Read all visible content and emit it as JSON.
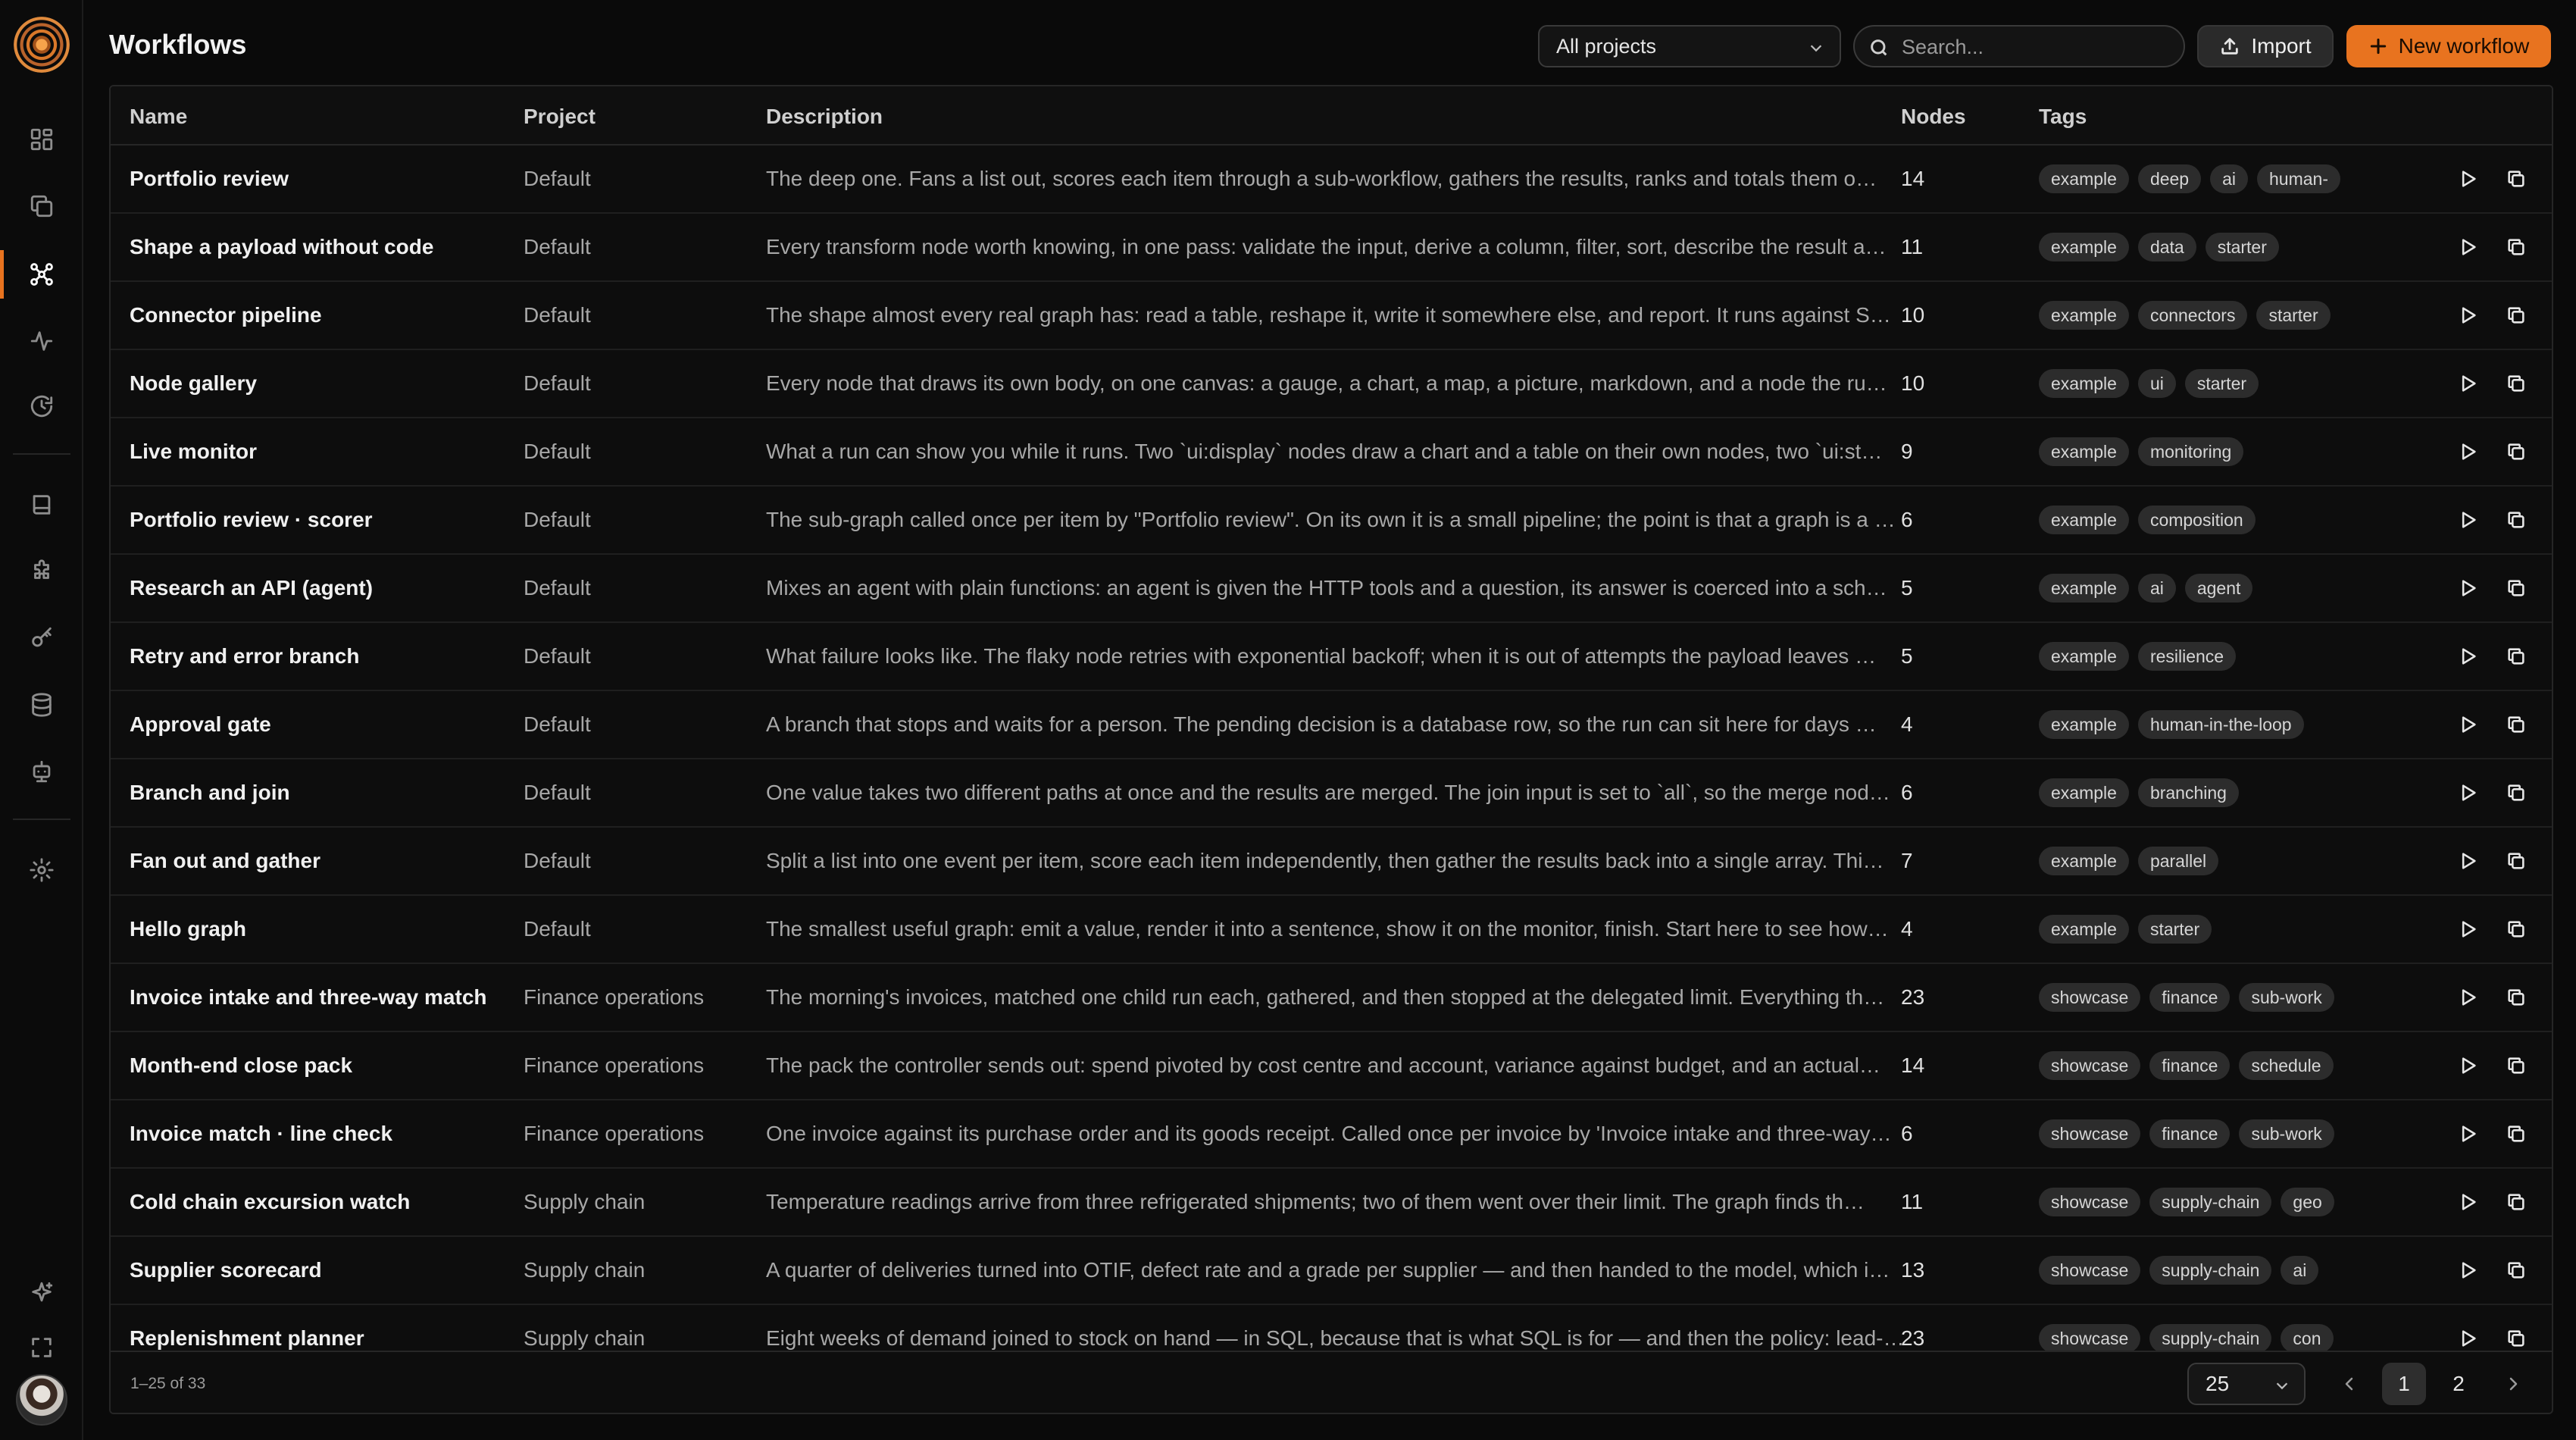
{
  "page": {
    "title": "Workflows"
  },
  "toolbar": {
    "project_filter": "All projects",
    "search_placeholder": "Search...",
    "import_label": "Import",
    "new_label": "New workflow",
    "accent": "#e8731f"
  },
  "sidebar": {
    "items": [
      {
        "name": "dashboard-icon"
      },
      {
        "name": "copy-stack-icon"
      },
      {
        "name": "workflows-icon",
        "active": true
      },
      {
        "name": "activity-icon"
      },
      {
        "name": "history-icon"
      },
      {
        "name": "book-icon"
      },
      {
        "name": "puzzle-icon"
      },
      {
        "name": "key-icon"
      },
      {
        "name": "database-icon"
      },
      {
        "name": "robot-icon"
      },
      {
        "name": "settings-icon"
      },
      {
        "name": "sparkle-icon"
      },
      {
        "name": "fullscreen-icon"
      }
    ]
  },
  "table": {
    "columns": {
      "name": "Name",
      "project": "Project",
      "description": "Description",
      "nodes": "Nodes",
      "tags": "Tags"
    },
    "rows": [
      {
        "name": "Portfolio review",
        "project": "Default",
        "description": "The deep one. Fans a list out, scores each item through a sub-workflow, gathers the results, ranks and totals them o…",
        "nodes": "14",
        "tags": [
          "example",
          "deep",
          "ai",
          "human-"
        ]
      },
      {
        "name": "Shape a payload without code",
        "project": "Default",
        "description": "Every transform node worth knowing, in one pass: validate the input, derive a column, filter, sort, describe the result a…",
        "nodes": "11",
        "tags": [
          "example",
          "data",
          "starter"
        ]
      },
      {
        "name": "Connector pipeline",
        "project": "Default",
        "description": "The shape almost every real graph has: read a table, reshape it, write it somewhere else, and report. It runs against S…",
        "nodes": "10",
        "tags": [
          "example",
          "connectors",
          "starter"
        ]
      },
      {
        "name": "Node gallery",
        "project": "Default",
        "description": "Every node that draws its own body, on one canvas: a gauge, a chart, a map, a picture, markdown, and a node the ru…",
        "nodes": "10",
        "tags": [
          "example",
          "ui",
          "starter"
        ]
      },
      {
        "name": "Live monitor",
        "project": "Default",
        "description": "What a run can show you while it runs. Two `ui:display` nodes draw a chart and a table on their own nodes, two `ui:st…",
        "nodes": "9",
        "tags": [
          "example",
          "monitoring"
        ]
      },
      {
        "name": "Portfolio review · scorer",
        "project": "Default",
        "description": "The sub-graph called once per item by \"Portfolio review\". On its own it is a small pipeline; the point is that a graph is a …",
        "nodes": "6",
        "tags": [
          "example",
          "composition"
        ]
      },
      {
        "name": "Research an API (agent)",
        "project": "Default",
        "description": "Mixes an agent with plain functions: an agent is given the HTTP tools and a question, its answer is coerced into a sch…",
        "nodes": "5",
        "tags": [
          "example",
          "ai",
          "agent"
        ]
      },
      {
        "name": "Retry and error branch",
        "project": "Default",
        "description": "What failure looks like. The flaky node retries with exponential backoff; when it is out of attempts the payload leaves …",
        "nodes": "5",
        "tags": [
          "example",
          "resilience"
        ]
      },
      {
        "name": "Approval gate",
        "project": "Default",
        "description": "A branch that stops and waits for a person. The pending decision is a database row, so the run can sit here for days …",
        "nodes": "4",
        "tags": [
          "example",
          "human-in-the-loop"
        ]
      },
      {
        "name": "Branch and join",
        "project": "Default",
        "description": "One value takes two different paths at once and the results are merged. The join input is set to `all`, so the merge nod…",
        "nodes": "6",
        "tags": [
          "example",
          "branching"
        ]
      },
      {
        "name": "Fan out and gather",
        "project": "Default",
        "description": "Split a list into one event per item, score each item independently, then gather the results back into a single array. Thi…",
        "nodes": "7",
        "tags": [
          "example",
          "parallel"
        ]
      },
      {
        "name": "Hello graph",
        "project": "Default",
        "description": "The smallest useful graph: emit a value, render it into a sentence, show it on the monitor, finish. Start here to see how…",
        "nodes": "4",
        "tags": [
          "example",
          "starter"
        ]
      },
      {
        "name": "Invoice intake and three-way match",
        "project": "Finance operations",
        "description": "The morning's invoices, matched one child run each, gathered, and then stopped at the delegated limit. Everything th…",
        "nodes": "23",
        "tags": [
          "showcase",
          "finance",
          "sub-work"
        ]
      },
      {
        "name": "Month-end close pack",
        "project": "Finance operations",
        "description": "The pack the controller sends out: spend pivoted by cost centre and account, variance against budget, and an actual…",
        "nodes": "14",
        "tags": [
          "showcase",
          "finance",
          "schedule"
        ]
      },
      {
        "name": "Invoice match · line check",
        "project": "Finance operations",
        "description": "One invoice against its purchase order and its goods receipt. Called once per invoice by 'Invoice intake and three-way…",
        "nodes": "6",
        "tags": [
          "showcase",
          "finance",
          "sub-work"
        ]
      },
      {
        "name": "Cold chain excursion watch",
        "project": "Supply chain",
        "description": "Temperature readings arrive from three refrigerated shipments; two of them went over their limit. The graph finds th…",
        "nodes": "11",
        "tags": [
          "showcase",
          "supply-chain",
          "geo"
        ]
      },
      {
        "name": "Supplier scorecard",
        "project": "Supply chain",
        "description": "A quarter of deliveries turned into OTIF, defect rate and a grade per supplier — and then handed to the model, which i…",
        "nodes": "13",
        "tags": [
          "showcase",
          "supply-chain",
          "ai"
        ]
      },
      {
        "name": "Replenishment planner",
        "project": "Supply chain",
        "description": "Eight weeks of demand joined to stock on hand — in SQL, because that is what SQL is for — and then the policy: lead-…",
        "nodes": "23",
        "tags": [
          "showcase",
          "supply-chain",
          "con"
        ]
      }
    ]
  },
  "footer": {
    "range": "1–25 of 33",
    "page_size": "25",
    "pages": [
      "1",
      "2"
    ],
    "current_page": "1"
  }
}
